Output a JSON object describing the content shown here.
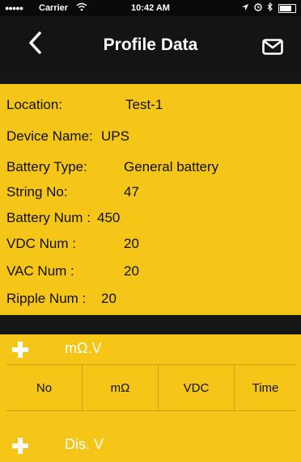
{
  "status_bar": {
    "signal": "●●●●●",
    "carrier": "Carrier",
    "time": "10:42 AM"
  },
  "nav": {
    "back_icon": "chevron-left-icon",
    "title": "Profile Data",
    "mail_icon": "mail-icon"
  },
  "profile": [
    {
      "label": "Location:",
      "value": "Test-1"
    },
    {
      "label": "Device Name:",
      "value": "UPS"
    },
    {
      "label": "Battery Type:",
      "value": "General battery"
    },
    {
      "label": "String No:",
      "value": "47"
    },
    {
      "label": "Battery Num :",
      "value": "450"
    },
    {
      "label": "VDC Num :",
      "value": "20"
    },
    {
      "label": "VAC Num :",
      "value": "20"
    },
    {
      "label": "Ripple Num :",
      "value": "20"
    }
  ],
  "sections": {
    "mohm": {
      "label": "mΩ.V"
    },
    "dis": {
      "label": "Dis. V"
    }
  },
  "table": {
    "columns": [
      "No",
      "mΩ",
      "VDC",
      "Time"
    ]
  },
  "colors": {
    "accent": "#f5c518",
    "bar": "#141414"
  }
}
